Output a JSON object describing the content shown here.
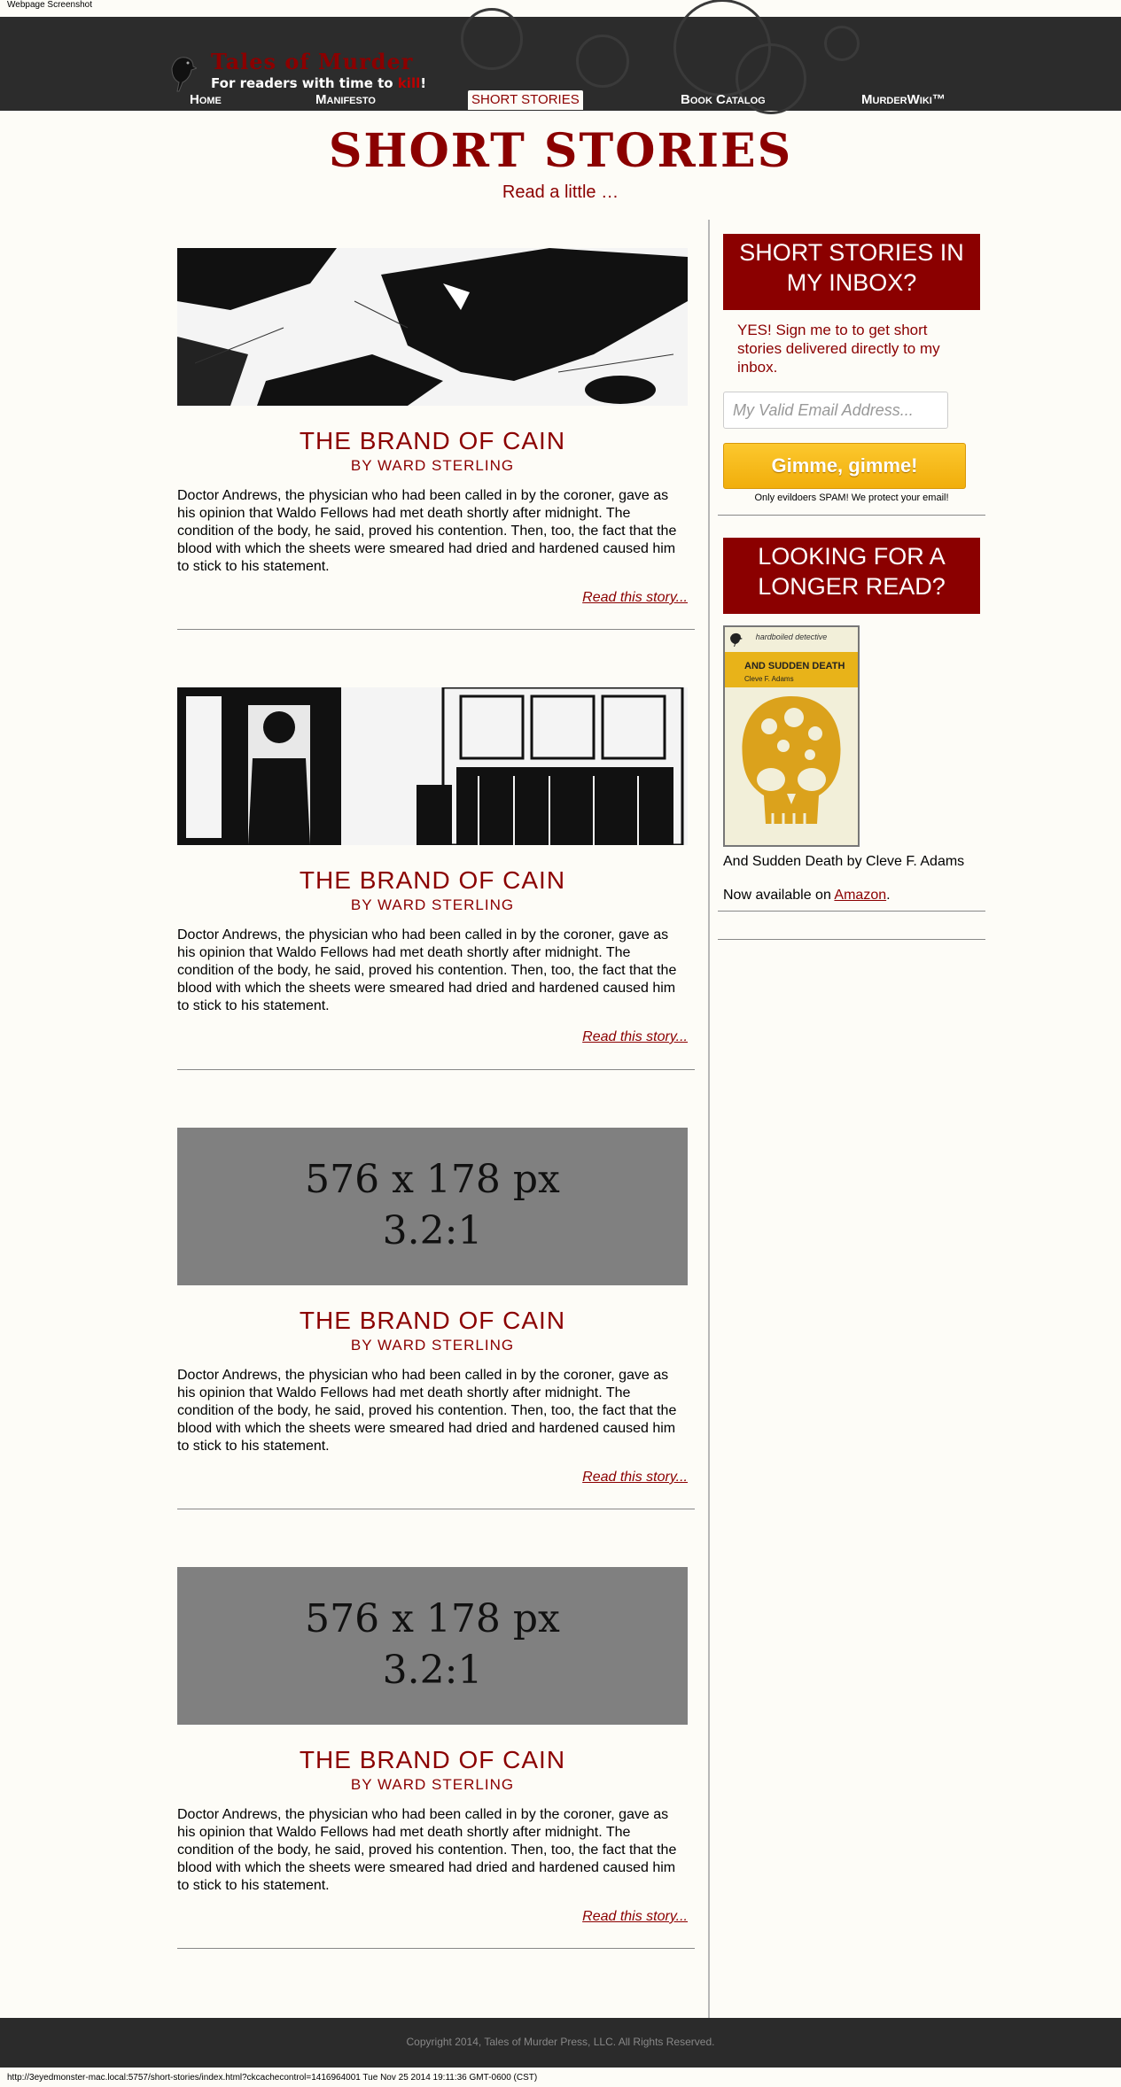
{
  "caption": "Webpage Screenshot",
  "logo": {
    "title": "Tales of Murder",
    "tagline_before": "For readers with time to ",
    "tagline_red": "kill",
    "tagline_after": "!"
  },
  "nav": [
    {
      "label": "Home"
    },
    {
      "label": "Manifesto"
    },
    {
      "label": "SHORT STORIES"
    },
    {
      "label": "Book Catalog"
    },
    {
      "label": "MurderWiki™"
    }
  ],
  "page": {
    "title": "SHORT STORIES",
    "subtitle": "Read a little …"
  },
  "stories": [
    {
      "title": "THE BRAND OF CAIN",
      "author": "BY WARD STERLING",
      "excerpt": "Doctor Andrews, the physician who had been called in by the coroner, gave as his opinion that Waldo Fellows had met death shortly after midnight. The condition of the body, he said, proved his contention. Then, too, the fact that the blood with which the sheets were smeared had dried and hardened caused him to stick to his statement.",
      "read_more": "Read this story..."
    },
    {
      "title": "THE BRAND OF CAIN",
      "author": "BY WARD STERLING",
      "excerpt": "Doctor Andrews, the physician who had been called in by the coroner, gave as his opinion that Waldo Fellows had met death shortly after midnight. The condition of the body, he said, proved his contention. Then, too, the fact that the blood with which the sheets were smeared had dried and hardened caused him to stick to his statement.",
      "read_more": "Read this story..."
    },
    {
      "placeholder_size": "576 x 178 px",
      "placeholder_ratio": "3.2:1",
      "title": "THE BRAND OF CAIN",
      "author": "BY WARD STERLING",
      "excerpt": "Doctor Andrews, the physician who had been called in by the coroner, gave as his opinion that Waldo Fellows had met death shortly after midnight. The condition of the body, he said, proved his contention. Then, too, the fact that the blood with which the sheets were smeared had dried and hardened caused him to stick to his statement.",
      "read_more": "Read this story..."
    },
    {
      "placeholder_size": "576 x 178 px",
      "placeholder_ratio": "3.2:1",
      "title": "THE BRAND OF CAIN",
      "author": "BY WARD STERLING",
      "excerpt": "Doctor Andrews, the physician who had been called in by the coroner, gave as his opinion that Waldo Fellows had met death shortly after midnight. The condition of the body, he said, proved his contention. Then, too, the fact that the blood with which the sheets were smeared had dried and hardened caused him to stick to his statement.",
      "read_more": "Read this story..."
    }
  ],
  "sidebar": {
    "signup_heading": "SHORT STORIES IN MY INBOX?",
    "signup_text": "YES! Sign me to to get short stories delivered directly to my inbox.",
    "email_placeholder": "My Valid Email Address...",
    "submit_label": "Gimme, gimme!",
    "spam_note": "Only evildoers SPAM! We protect your email!",
    "longer_heading": "LOOKING FOR A LONGER READ?",
    "book": {
      "series": "hardboiled detective",
      "cover_title": "AND SUDDEN DEATH",
      "cover_author": "Cleve F. Adams",
      "caption": "And Sudden Death by Cleve F. Adams",
      "available_prefix": "Now available on ",
      "available_link": "Amazon",
      "available_suffix": "."
    }
  },
  "footer": {
    "copyright": "Copyright 2014, Tales of Murder Press, LLC. All Rights Reserved."
  },
  "statusbar": "http://3eyedmonster-mac.local:5757/short-stories/index.html?ckcachecontrol=1416964001 Tue Nov 25 2014 19:11:36 GMT-0600 (CST)",
  "colors": {
    "accent": "#8b0000",
    "header_bg": "#2c2c2c",
    "button": "#f1ae0b",
    "placeholder_bg": "#808080"
  }
}
